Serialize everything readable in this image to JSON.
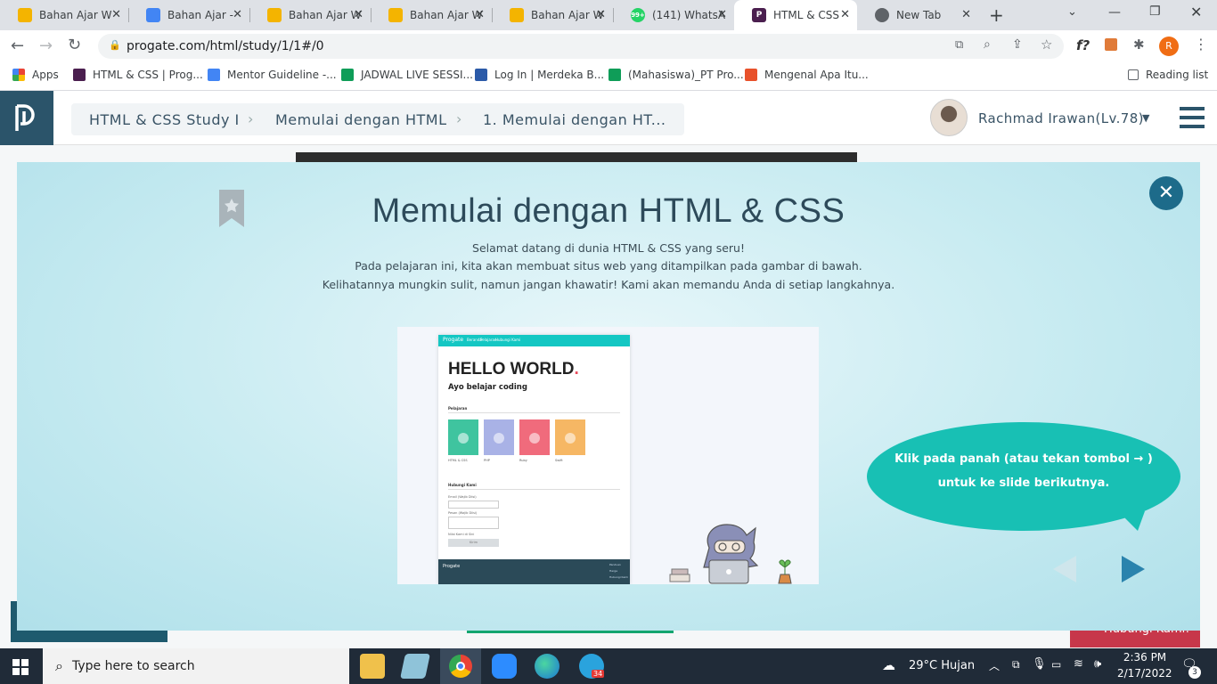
{
  "browser": {
    "tabs": [
      {
        "title": "Bahan Ajar W",
        "color": "#f4b400"
      },
      {
        "title": "Bahan Ajar - ",
        "color": "#4285f4"
      },
      {
        "title": "Bahan Ajar W",
        "color": "#f4b400"
      },
      {
        "title": "Bahan Ajar W",
        "color": "#f4b400"
      },
      {
        "title": "Bahan Ajar W",
        "color": "#f4b400"
      },
      {
        "title": "(141) WhatsA",
        "color": "#25d366",
        "badge": "99+"
      },
      {
        "title": "HTML & CSS",
        "color": "#4b1f4f",
        "active": true
      },
      {
        "title": "New Tab",
        "color": "#5f6368"
      }
    ],
    "url": "progate.com/html/study/1/1#/0",
    "profile_initial": "R",
    "bookmarks": [
      {
        "label": "Apps",
        "color": "#ea4335"
      },
      {
        "label": "HTML & CSS | Prog...",
        "color": "#4b1f4f"
      },
      {
        "label": "Mentor Guideline -...",
        "color": "#4285f4"
      },
      {
        "label": "JADWAL LIVE SESSI...",
        "color": "#0f9d58"
      },
      {
        "label": "Log In | Merdeka B...",
        "color": "#2b5aa8"
      },
      {
        "label": "(Mahasiswa)_PT Pro...",
        "color": "#0f9d58"
      },
      {
        "label": "Mengenal Apa Itu...",
        "color": "#e8512b"
      }
    ],
    "reading_list": "Reading list"
  },
  "header": {
    "breadcrumbs": [
      "HTML & CSS Study I",
      "Memulai dengan HTML",
      "1. Memulai dengan HT..."
    ],
    "user_name": "Rachmad Irawan(Lv.78)",
    "brand_color": "#2b546a"
  },
  "modal": {
    "title": "Memulai dengan HTML & CSS",
    "lines": [
      "Selamat datang di dunia HTML & CSS yang seru!",
      "Pada pelajaran ini, kita akan membuat situs web yang ditampilkan pada gambar di bawah.",
      "Kelihatannya mungkin sulit, namun jangan khawatir! Kami akan memandu Anda di setiap langkahnya."
    ],
    "bubble_line1": "Klik pada panah (atau tekan tombol → )",
    "bubble_line2": "untuk ke slide berikutnya.",
    "accent": "#18c0b4",
    "preview": {
      "brand": "Progate",
      "nav": [
        "Beranda",
        "Pelajaran",
        "Hubungi Kami"
      ],
      "hero_title": "HELLO WORLD",
      "hero_dot": ".",
      "hero_sub": "Ayo belajar coding",
      "section_lessons": "Pelajaran",
      "lessons": [
        {
          "label": "HTML & CSS",
          "color": "#3fc49f"
        },
        {
          "label": "PHP",
          "color": "#a9b2e6"
        },
        {
          "label": "Ruby",
          "color": "#f06b7c"
        },
        {
          "label": "Swift",
          "color": "#f6b764"
        }
      ],
      "section_contact": "Hubungi Kami",
      "field_email": "Email (Wajib Diisi)",
      "field_message": "Pesan (Wajib Diisi)",
      "field_extra": "Nilai Kami di Sini",
      "submit": "Kirim",
      "footer_brand": "Progate",
      "footer_links": [
        "Panduan",
        "Harga",
        "Hubungi Kami"
      ]
    }
  },
  "background": {
    "contact_button": "Hubungi Kami!"
  },
  "taskbar": {
    "search_placeholder": "Type here to search",
    "weather": "29°C  Hujan",
    "time": "2:36 PM",
    "date": "2/17/2022",
    "notifications": "3",
    "telegram_badge": "34"
  }
}
